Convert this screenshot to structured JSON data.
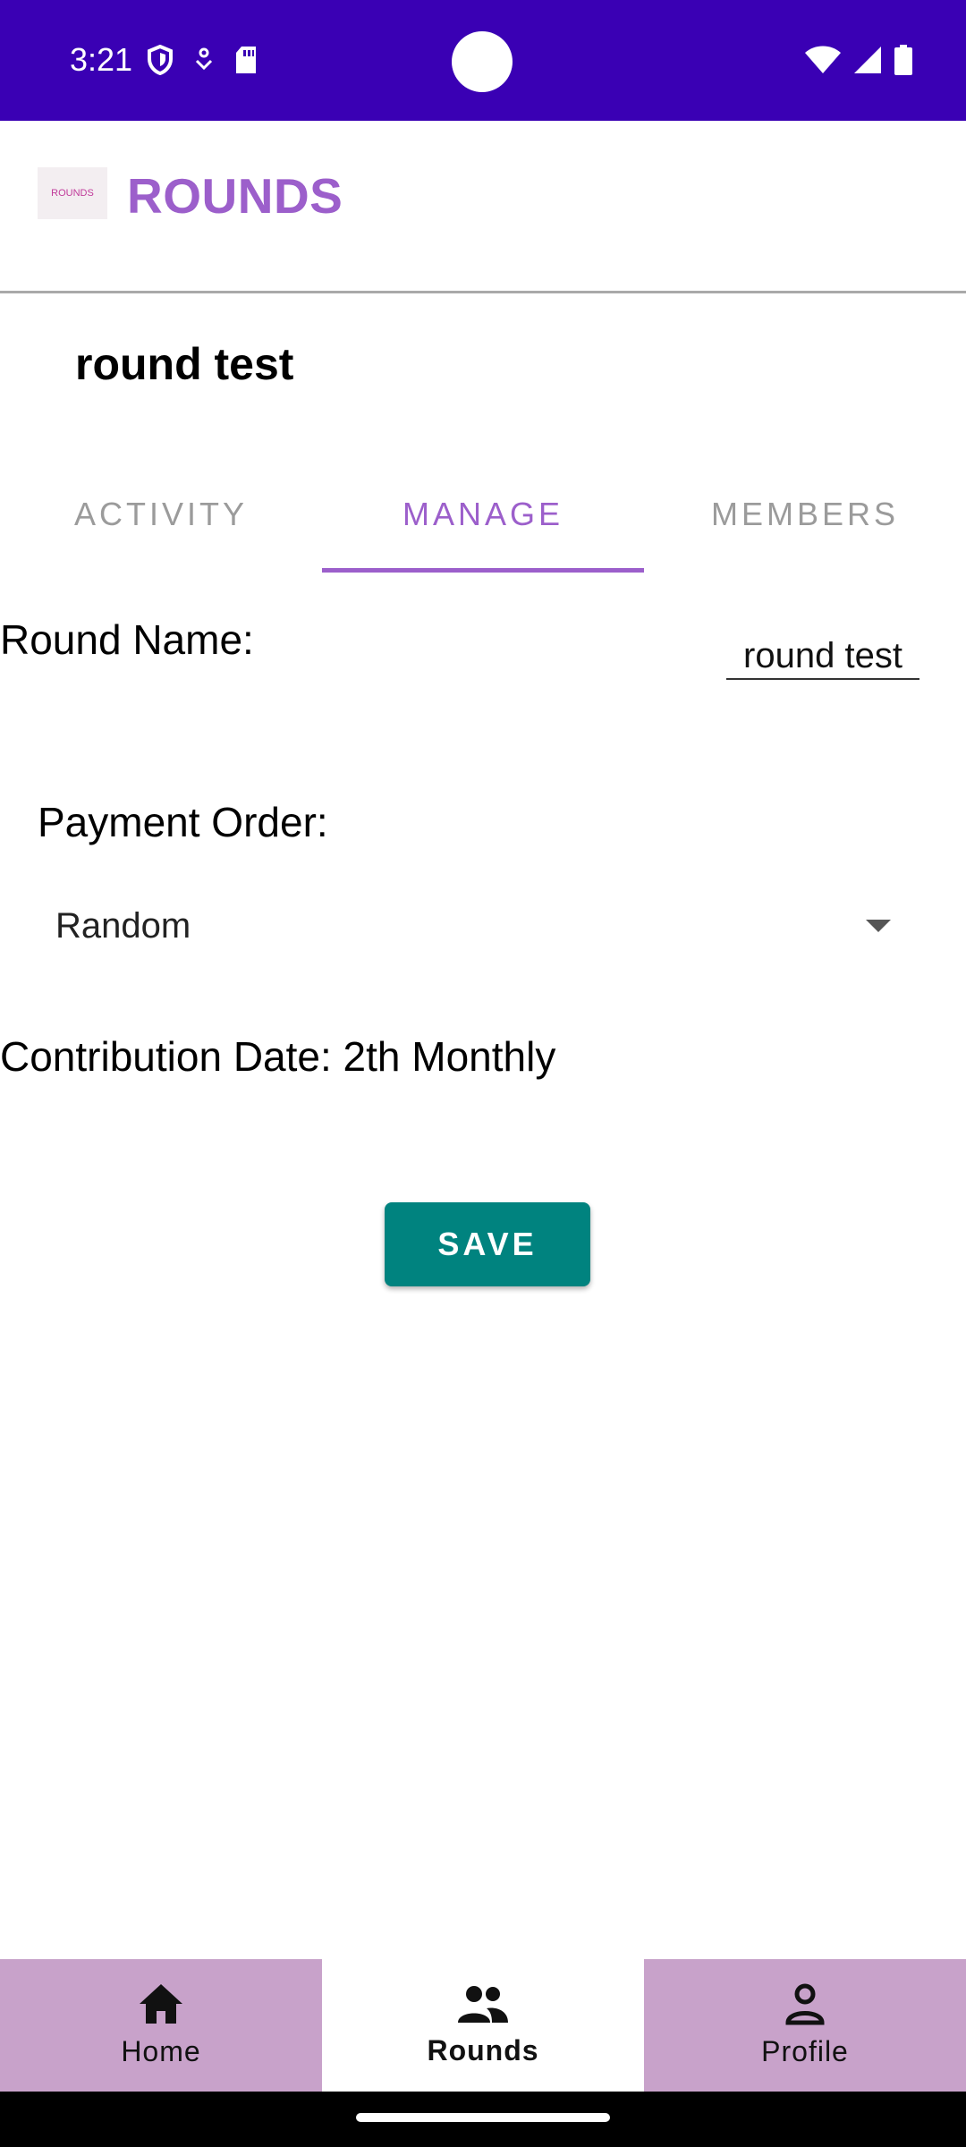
{
  "status_bar": {
    "time": "3:21",
    "left_icons": [
      "shield-icon",
      "download-icon",
      "sd-card-icon"
    ],
    "right_icons": [
      "wifi-icon",
      "signal-icon",
      "battery-icon"
    ],
    "color": "#3a00b4"
  },
  "app_bar": {
    "logo_text": "ROUNDS",
    "title": "ROUNDS",
    "title_color": "#9c5fcb"
  },
  "round": {
    "title": "round test"
  },
  "tabs": [
    {
      "label": "ACTIVITY",
      "active": false
    },
    {
      "label": "MANAGE",
      "active": true
    },
    {
      "label": "MEMBERS",
      "active": false
    }
  ],
  "manage": {
    "round_name_label": "Round Name:",
    "round_name_value": "round test",
    "payment_order_label": "Payment Order:",
    "payment_order_value": "Random",
    "contribution_date": "Contribution Date: 2th Monthly",
    "save_label": "SAVE",
    "save_color": "#00837f"
  },
  "bottom_nav": [
    {
      "label": "Home",
      "icon": "home-icon",
      "active": false
    },
    {
      "label": "Rounds",
      "icon": "group-icon",
      "active": true
    },
    {
      "label": "Profile",
      "icon": "person-icon",
      "active": false
    }
  ],
  "nav_color": "#c8a2ca"
}
